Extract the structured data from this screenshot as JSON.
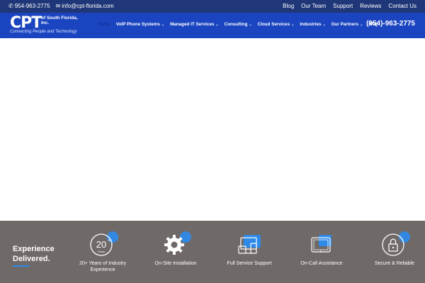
{
  "topbar": {
    "phone": "954-963-2775",
    "email": "info@cpt-florida.com",
    "links": [
      "Blog",
      "Our Team",
      "Support",
      "Reviews",
      "Contact Us"
    ]
  },
  "logo": {
    "main": "CPT",
    "sub": "of South Florida, Inc.",
    "tagline": "Connecting People and Technology"
  },
  "nav": {
    "items": [
      {
        "label": "Home",
        "dropdown": false
      },
      {
        "label": "VoIP Phone Systems",
        "dropdown": true
      },
      {
        "label": "Managed IT Services",
        "dropdown": true
      },
      {
        "label": "Consulting",
        "dropdown": true
      },
      {
        "label": "Cloud Services",
        "dropdown": true
      },
      {
        "label": "Industries",
        "dropdown": true
      },
      {
        "label": "Our Partners",
        "dropdown": true
      },
      {
        "label": "FAQ",
        "dropdown": false
      }
    ],
    "phone": "(954)-963-2775"
  },
  "band": {
    "title_line1": "Experience",
    "title_line2": "Delivered.",
    "features": [
      {
        "label": "20+ Years of Industry Experience",
        "icon": "badge-20-years-icon",
        "badge_number": "20",
        "badge_plus": "+",
        "badge_word": "Years"
      },
      {
        "label": "On-Site Installation",
        "icon": "gear-icon"
      },
      {
        "label": "Full Service Support",
        "icon": "devices-icon"
      },
      {
        "label": "On-Call Assistance",
        "icon": "tablet-icon"
      },
      {
        "label": "Secure & Reliable",
        "icon": "lock-shield-icon"
      }
    ]
  },
  "colors": {
    "topbar_bg": "#1f3778",
    "header_bg": "#1b44c0",
    "band_bg": "#6f6968",
    "accent": "#2e8ae8"
  }
}
